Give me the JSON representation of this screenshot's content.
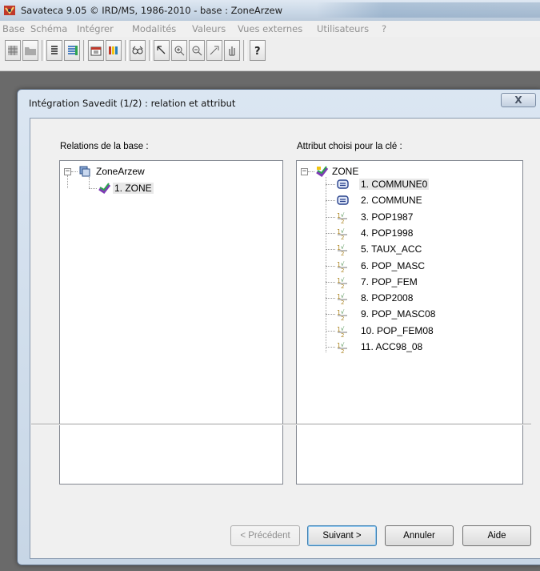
{
  "window": {
    "title": "Savateca 9.05 © IRD/MS, 1986-2010  -  base : ZoneArzew"
  },
  "menu": [
    "Base",
    "Schéma",
    "Intégrer",
    "Modalités",
    "Valeurs",
    "Vues externes",
    "Utilisateurs",
    "?"
  ],
  "dialog": {
    "title": "Intégration Savedit (1/2) : relation et attribut",
    "close_label": "X",
    "left_label": "Relations de la base :",
    "right_label": "Attribut choisi pour la clé :",
    "left_tree": {
      "root": "ZoneArzew",
      "children": [
        "1. ZONE"
      ]
    },
    "right_tree": {
      "root": "ZONE",
      "children": [
        {
          "label": "1. COMMUNE0",
          "icon": "text-field-icon"
        },
        {
          "label": "2. COMMUNE",
          "icon": "text-field-icon"
        },
        {
          "label": "3. POP1987",
          "icon": "numeric-field-icon"
        },
        {
          "label": "4. POP1998",
          "icon": "numeric-field-icon"
        },
        {
          "label": "5. TAUX_ACC",
          "icon": "numeric-field-icon"
        },
        {
          "label": "6. POP_MASC",
          "icon": "numeric-field-icon"
        },
        {
          "label": "7. POP_FEM",
          "icon": "numeric-field-icon"
        },
        {
          "label": "8. POP2008",
          "icon": "numeric-field-icon"
        },
        {
          "label": "9. POP_MASC08",
          "icon": "numeric-field-icon"
        },
        {
          "label": "10. POP_FEM08",
          "icon": "numeric-field-icon"
        },
        {
          "label": "11. ACC98_08",
          "icon": "numeric-field-icon"
        }
      ]
    },
    "buttons": {
      "previous": "< Précédent",
      "next": "Suivant >",
      "cancel": "Annuler",
      "help": "Aide"
    }
  },
  "colors": {
    "accent": "#3c7fb1",
    "selection": "#e8e8e8"
  }
}
